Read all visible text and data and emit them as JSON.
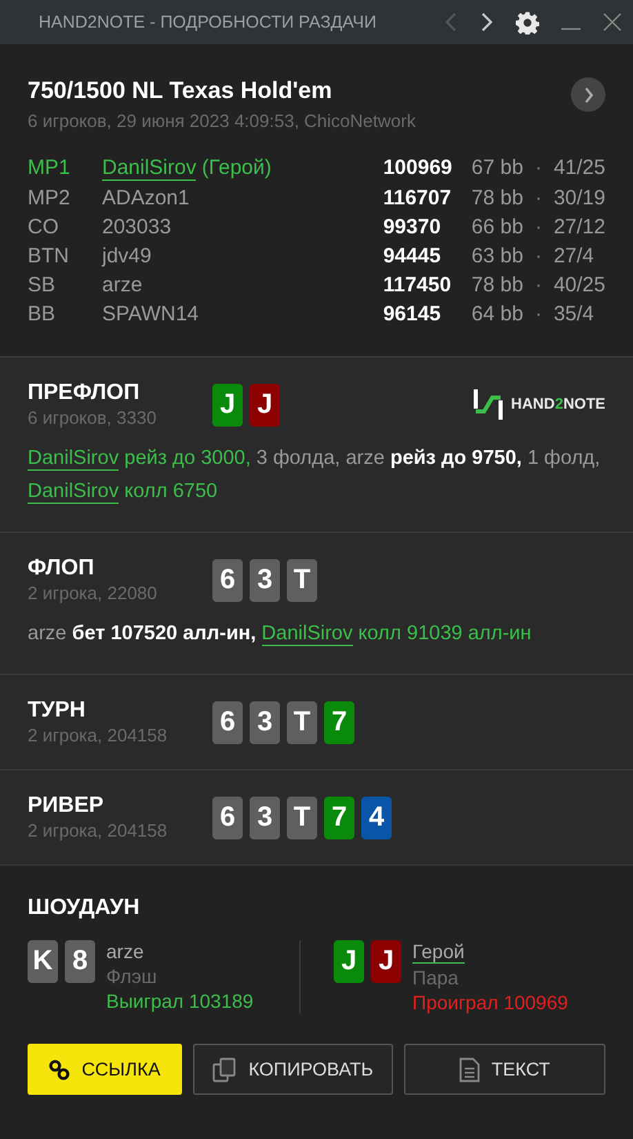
{
  "window": {
    "title": "HAND2NOTE - ПОДРОБНОСТИ РАЗДАЧИ",
    "nav": [
      {
        "kind": "prev",
        "disabled": true
      },
      {
        "kind": "next",
        "disabled": false
      }
    ]
  },
  "hand": {
    "title": "750/1500 NL Texas Hold'em",
    "subtitle": "6 игроков, 29 июня 2023 4:09:53, ChicoNetwork"
  },
  "players": [
    {
      "position": "MP1",
      "name": "DanilSirov",
      "name_suffix": "(Герой)",
      "hero": true,
      "stack": "100969",
      "bb": "67 bb",
      "dot": "·",
      "stats": "41/25"
    },
    {
      "position": "MP2",
      "name": "ADAzon1",
      "hero": false,
      "stack": "116707",
      "bb": "78 bb",
      "dot": "·",
      "stats": "30/19"
    },
    {
      "position": "CO",
      "name": "203033",
      "hero": false,
      "stack": "99370",
      "bb": "66 bb",
      "dot": "·",
      "stats": "27/12"
    },
    {
      "position": "BTN",
      "name": "jdv49",
      "hero": false,
      "stack": "94445",
      "bb": "63 bb",
      "dot": "·",
      "stats": "27/4"
    },
    {
      "position": "SB",
      "name": "arze",
      "hero": false,
      "stack": "117450",
      "bb": "78 bb",
      "dot": "·",
      "stats": "40/25"
    },
    {
      "position": "BB",
      "name": "SPAWN14",
      "hero": false,
      "stack": "96145",
      "bb": "64 bb",
      "dot": "·",
      "stats": "35/4"
    }
  ],
  "streets": [
    {
      "name": "ПРЕФЛОП",
      "info": "6 игроков, 3330",
      "cards": [
        {
          "rank": "J",
          "color": "#0a8a0a"
        },
        {
          "rank": "J",
          "color": "#8c0000"
        }
      ],
      "logo": [
        "HAND",
        "2",
        "NOTE"
      ],
      "actions": [
        {
          "kind": "hero",
          "text": "DanilSirov"
        },
        {
          "kind": "hero-action",
          "text": "рейз до 3000,"
        },
        {
          "kind": "plain",
          "text": "3 фолда, arze"
        },
        {
          "kind": "bold",
          "text": "рейз до 9750,"
        },
        {
          "kind": "plain",
          "text": "1 фолд,"
        },
        {
          "kind": "hero",
          "text": "DanilSirov"
        },
        {
          "kind": "hero-action",
          "text": "колл 6750"
        }
      ]
    },
    {
      "name": "ФЛОП",
      "info": "2 игрока, 22080",
      "cards": [
        {
          "rank": "6",
          "color": "#5f5f5f"
        },
        {
          "rank": "3",
          "color": "#5f5f5f"
        },
        {
          "rank": "T",
          "color": "#5f5f5f"
        }
      ],
      "actions": [
        {
          "kind": "plain",
          "text": "arze"
        },
        {
          "kind": "bold",
          "text": "бет 107520 алл-ин,"
        },
        {
          "kind": "hero",
          "text": "DanilSirov"
        },
        {
          "kind": "hero-action",
          "text": "колл 91039 алл-ин"
        }
      ]
    },
    {
      "name": "ТУРН",
      "info": "2 игрока, 204158",
      "cards": [
        {
          "rank": "6",
          "color": "#5f5f5f"
        },
        {
          "rank": "3",
          "color": "#5f5f5f"
        },
        {
          "rank": "T",
          "color": "#5f5f5f"
        },
        {
          "rank": "7",
          "color": "#0a8a0a"
        }
      ]
    },
    {
      "name": "РИВЕР",
      "info": "2 игрока, 204158",
      "cards": [
        {
          "rank": "6",
          "color": "#5f5f5f"
        },
        {
          "rank": "3",
          "color": "#5f5f5f"
        },
        {
          "rank": "T",
          "color": "#5f5f5f"
        },
        {
          "rank": "7",
          "color": "#0a8a0a"
        },
        {
          "rank": "4",
          "color": "#0a55a8"
        }
      ]
    }
  ],
  "showdown": {
    "title": "ШОУДАУН",
    "hands": [
      {
        "cards": [
          {
            "rank": "K",
            "color": "#5f5f5f"
          },
          {
            "rank": "8",
            "color": "#5f5f5f"
          }
        ],
        "player": "arze",
        "hero": false,
        "combo": "Флэш",
        "result": "Выиграл 103189",
        "won": true
      },
      {
        "cards": [
          {
            "rank": "J",
            "color": "#0a8a0a"
          },
          {
            "rank": "J",
            "color": "#8c0000"
          }
        ],
        "player": "Герой",
        "hero": true,
        "combo": "Пара",
        "result": "Проиграл 100969",
        "won": false
      }
    ]
  },
  "buttons": [
    {
      "kind": "link",
      "label": "ССЫЛКА"
    },
    {
      "kind": "copy",
      "label": "КОПИРОВАТЬ"
    },
    {
      "kind": "text",
      "label": "ТЕКСТ"
    }
  ]
}
